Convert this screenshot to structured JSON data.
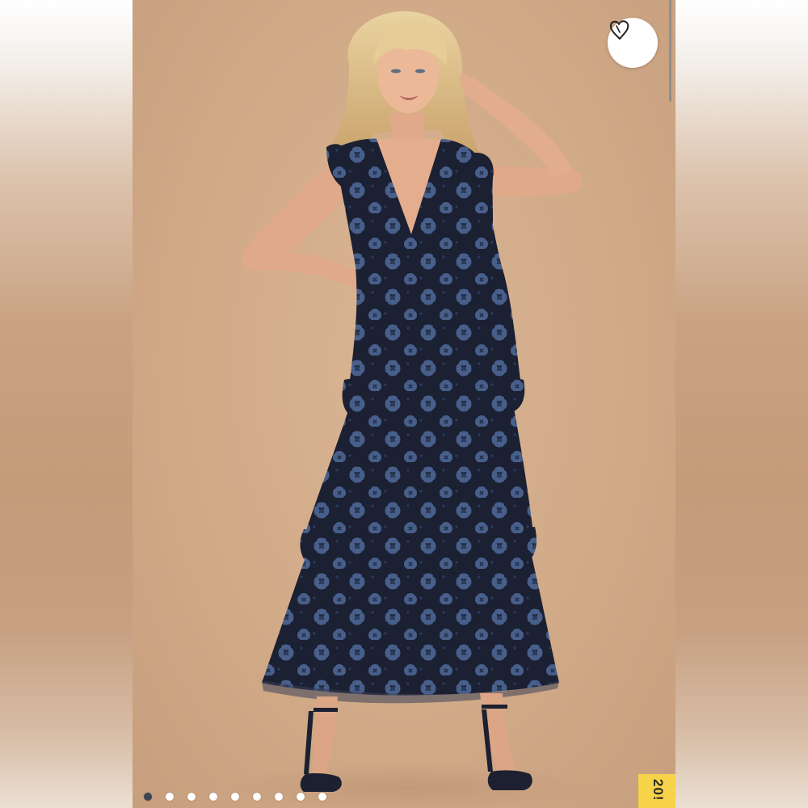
{
  "photo": {
    "alt_subject": "model-in-navy-lace-tiered-maxi-dress"
  },
  "favorite_button": {
    "icon": "heart-outline-icon"
  },
  "carousel": {
    "total_slides": 9,
    "active_index": 0
  },
  "promo_tab": {
    "label": "20!"
  },
  "colors": {
    "backdrop": "#d8b393",
    "dress_navy": "#1d2236",
    "dress_lace_blue": "#4a6592",
    "promo_yellow": "#f7d34a",
    "dot_active": "#3b4453"
  }
}
